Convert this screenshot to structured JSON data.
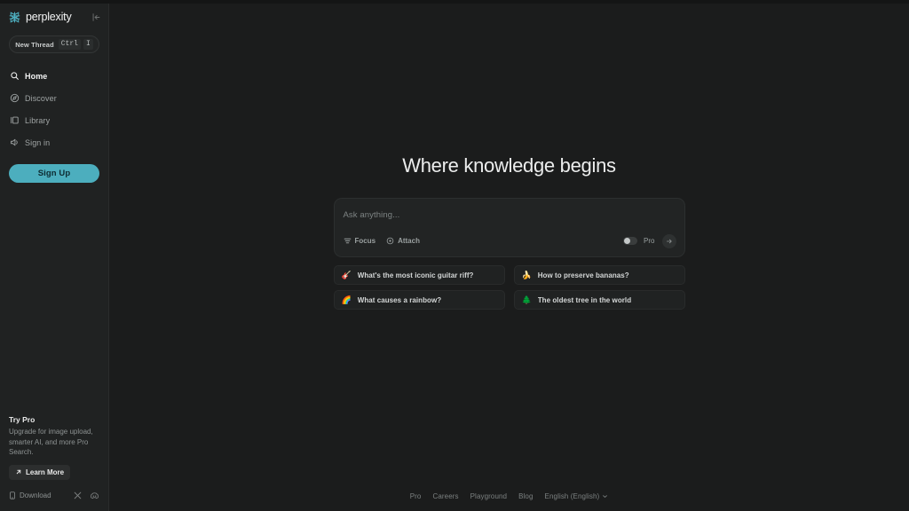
{
  "app": {
    "name": "Perplexity",
    "theme": "dark",
    "accent_color": "#4caebe",
    "background_color": "#1b1c1c",
    "sidebar_color": "#202222"
  },
  "sidebar": {
    "brand": {
      "name": "perplexity",
      "logo_icon": "perplexity-logo-icon"
    },
    "collapse": {
      "icon": "collapse-sidebar-icon"
    },
    "new_thread": {
      "label": "New Thread",
      "keys": [
        "Ctrl",
        "I"
      ]
    },
    "nav": [
      {
        "label": "Home",
        "icon": "search-icon",
        "active": true
      },
      {
        "label": "Discover",
        "icon": "compass-icon",
        "active": false
      },
      {
        "label": "Library",
        "icon": "library-icon",
        "active": false
      },
      {
        "label": "Sign in",
        "icon": "sign-in-icon",
        "active": false
      }
    ],
    "signup": {
      "label": "Sign Up"
    },
    "try_pro": {
      "title": "Try Pro",
      "description": "Upgrade for image upload, smarter AI, and more Pro Search.",
      "cta_label": "Learn More",
      "cta_icon": "arrow-up-right-icon"
    },
    "footer": {
      "download_label": "Download",
      "download_icon": "phone-icon",
      "social": [
        {
          "name": "x-twitter-icon"
        },
        {
          "name": "discord-icon"
        }
      ]
    }
  },
  "main": {
    "hero_title": "Where knowledge begins",
    "search": {
      "placeholder": "Ask anything...",
      "value": "",
      "focus_label": "Focus",
      "focus_icon": "sliders-icon",
      "attach_label": "Attach",
      "attach_icon": "attach-circle-icon",
      "pro_label": "Pro",
      "pro_enabled": false,
      "submit_icon": "arrow-right-icon"
    },
    "suggestions": [
      {
        "emoji": "🎸",
        "emoji_name": "guitar-emoji",
        "text": "What's the most iconic guitar riff?"
      },
      {
        "emoji": "🍌",
        "emoji_name": "banana-emoji",
        "text": "How to preserve bananas?"
      },
      {
        "emoji": "🌈",
        "emoji_name": "rainbow-emoji",
        "text": "What causes a rainbow?"
      },
      {
        "emoji": "🌲",
        "emoji_name": "evergreen-tree-emoji",
        "text": "The oldest tree in the world"
      }
    ],
    "footer_links": [
      {
        "label": "Pro"
      },
      {
        "label": "Careers"
      },
      {
        "label": "Playground"
      },
      {
        "label": "Blog"
      }
    ],
    "language": {
      "label": "English (English)",
      "chevron_icon": "chevron-down-icon"
    }
  }
}
